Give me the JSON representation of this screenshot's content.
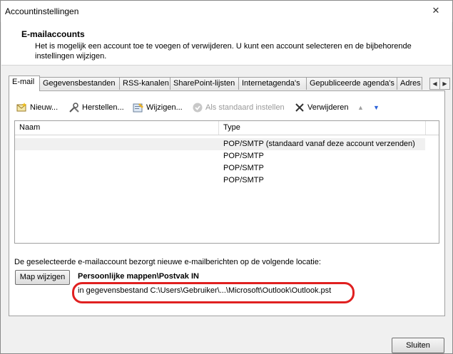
{
  "window": {
    "title": "Accountinstellingen",
    "close_glyph": "✕"
  },
  "header": {
    "title": "E-mailaccounts",
    "description": "Het is mogelijk een account toe te voegen of verwijderen. U kunt een account selecteren en de bijbehorende instellingen wijzigen."
  },
  "tabs": [
    {
      "label": "E-mail",
      "active": true
    },
    {
      "label": "Gegevensbestanden"
    },
    {
      "label": "RSS-kanalen"
    },
    {
      "label": "SharePoint-lijsten"
    },
    {
      "label": "Internetagenda's"
    },
    {
      "label": "Gepubliceerde agenda's"
    },
    {
      "label": "Adres"
    }
  ],
  "tab_scroll": {
    "left": "◀",
    "right": "▶"
  },
  "toolbar": {
    "new": "Nieuw...",
    "repair": "Herstellen...",
    "change": "Wijzigen...",
    "set_default": "Als standaard instellen",
    "remove": "Verwijderen",
    "up_glyph": "▲",
    "down_glyph": "▼"
  },
  "list": {
    "columns": [
      "Naam",
      "Type"
    ],
    "rows": [
      {
        "name": "",
        "type": "POP/SMTP (standaard vanaf deze account verzenden)"
      },
      {
        "name": "",
        "type": "POP/SMTP"
      },
      {
        "name": "",
        "type": "POP/SMTP"
      },
      {
        "name": "",
        "type": "POP/SMTP"
      }
    ]
  },
  "location": {
    "description": "De geselecteerde e-mailaccount bezorgt nieuwe e-mailberichten op de volgende locatie:",
    "button": "Map wijzigen",
    "folder": "Persoonlijke mappen\\Postvak IN",
    "path": "in gegevensbestand C:\\Users\\Gebruiker\\...\\Microsoft\\Outlook\\Outlook.pst"
  },
  "footer": {
    "close_button": "Sluiten"
  },
  "colors": {
    "highlight_oval": "#e02020",
    "arrow_blue": "#2b62d9"
  }
}
